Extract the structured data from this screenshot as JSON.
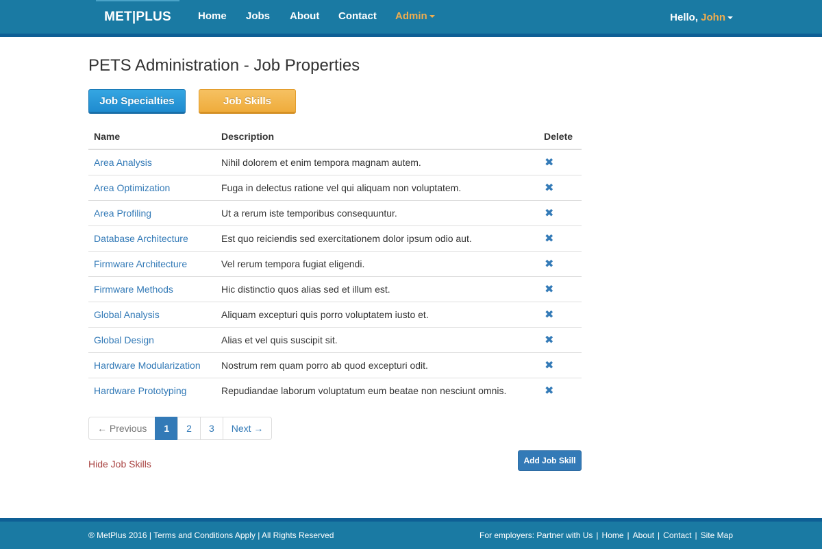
{
  "nav": {
    "brand": "MET|PLUS",
    "items": [
      {
        "label": "Home"
      },
      {
        "label": "Jobs"
      },
      {
        "label": "About"
      },
      {
        "label": "Contact"
      }
    ],
    "admin_label": "Admin",
    "hello_prefix": "Hello, ",
    "user_name": "John"
  },
  "page": {
    "title": "PETS Administration - Job Properties",
    "btn_specialties": "Job Specialties",
    "btn_skills": "Job Skills"
  },
  "table": {
    "headers": {
      "name": "Name",
      "description": "Description",
      "delete": "Delete"
    },
    "rows": [
      {
        "name": "Area Analysis",
        "description": "Nihil dolorem et enim tempora magnam autem."
      },
      {
        "name": "Area Optimization",
        "description": "Fuga in delectus ratione vel qui aliquam non voluptatem."
      },
      {
        "name": "Area Profiling",
        "description": "Ut a rerum iste temporibus consequuntur."
      },
      {
        "name": "Database Architecture",
        "description": "Est quo reiciendis sed exercitationem dolor ipsum odio aut."
      },
      {
        "name": "Firmware Architecture",
        "description": "Vel rerum tempora fugiat eligendi."
      },
      {
        "name": "Firmware Methods",
        "description": "Hic distinctio quos alias sed et illum est."
      },
      {
        "name": "Global Analysis",
        "description": "Aliquam excepturi quis porro voluptatem iusto et."
      },
      {
        "name": "Global Design",
        "description": "Alias et vel quis suscipit sit."
      },
      {
        "name": "Hardware Modularization",
        "description": "Nostrum rem quam porro ab quod excepturi odit."
      },
      {
        "name": "Hardware Prototyping",
        "description": "Repudiandae laborum voluptatum eum beatae non nesciunt omnis."
      }
    ],
    "delete_icon": "✖"
  },
  "pagination": {
    "previous": "← Previous",
    "pages": [
      "1",
      "2",
      "3"
    ],
    "active_page": "1",
    "next": "Next →"
  },
  "actions": {
    "hide_link": "Hide Job Skills",
    "add_button": "Add Job Skill"
  },
  "footer": {
    "left": "® MetPlus 2016 | Terms and Conditions Apply | All Rights Reserved",
    "right_prefix": "For employers: ",
    "links": [
      "Partner with Us",
      "Home",
      "About",
      "Contact",
      "Site Map"
    ]
  },
  "colors": {
    "navbar": "#1a7aa3",
    "navbar_border": "#0e5f95",
    "link": "#337ab7",
    "admin_accent": "#f0ad4e",
    "hide_link": "#a94442"
  }
}
